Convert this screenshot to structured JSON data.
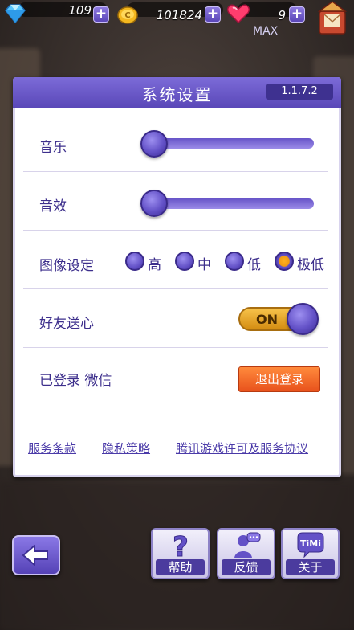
{
  "resources": {
    "diamonds": "109",
    "coins": "101824",
    "hearts": "9",
    "hearts_max": "MAX"
  },
  "panel": {
    "title": "系统设置",
    "version": "1.1.7.2"
  },
  "settings": {
    "music_label": "音乐",
    "music_level": 0.0,
    "sfx_label": "音效",
    "sfx_level": 0.0,
    "graphics_label": "图像设定",
    "graphics_options": [
      "高",
      "中",
      "低",
      "极低"
    ],
    "graphics_selected": "极低",
    "friend_hearts_label": "好友送心",
    "friend_hearts_toggle": "ON",
    "login_label": "已登录 微信",
    "logout_button": "退出登录"
  },
  "links": {
    "terms": "服务条款",
    "privacy": "隐私策略",
    "license": "腾讯游戏许可及服务协议"
  },
  "bottom": {
    "help": "帮助",
    "feedback": "反馈",
    "about": "关于",
    "timi_logo_text": "TiMi"
  },
  "colors": {
    "accent_purple": "#5a48b8",
    "label_purple": "#3d2f8c",
    "toggle_orange": "#f7c24a",
    "logout_orange": "#e8521c"
  }
}
